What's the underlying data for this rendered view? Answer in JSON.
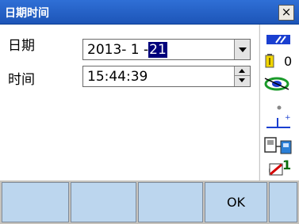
{
  "window": {
    "title": "日期时间",
    "close_label": "×"
  },
  "form": {
    "date_label": "日期",
    "date_value_prefix": "2013- 1 -",
    "date_value_selected": "21",
    "time_label": "时间",
    "time_value": "15:44:39"
  },
  "status": {
    "battery_count": "0",
    "channel_number": "1"
  },
  "softkeys": [
    "",
    "",
    "",
    "OK",
    ""
  ],
  "colors": {
    "titlebar": "#1d55b8",
    "selection": "#00007b",
    "softkey": "#bcd6ee"
  }
}
